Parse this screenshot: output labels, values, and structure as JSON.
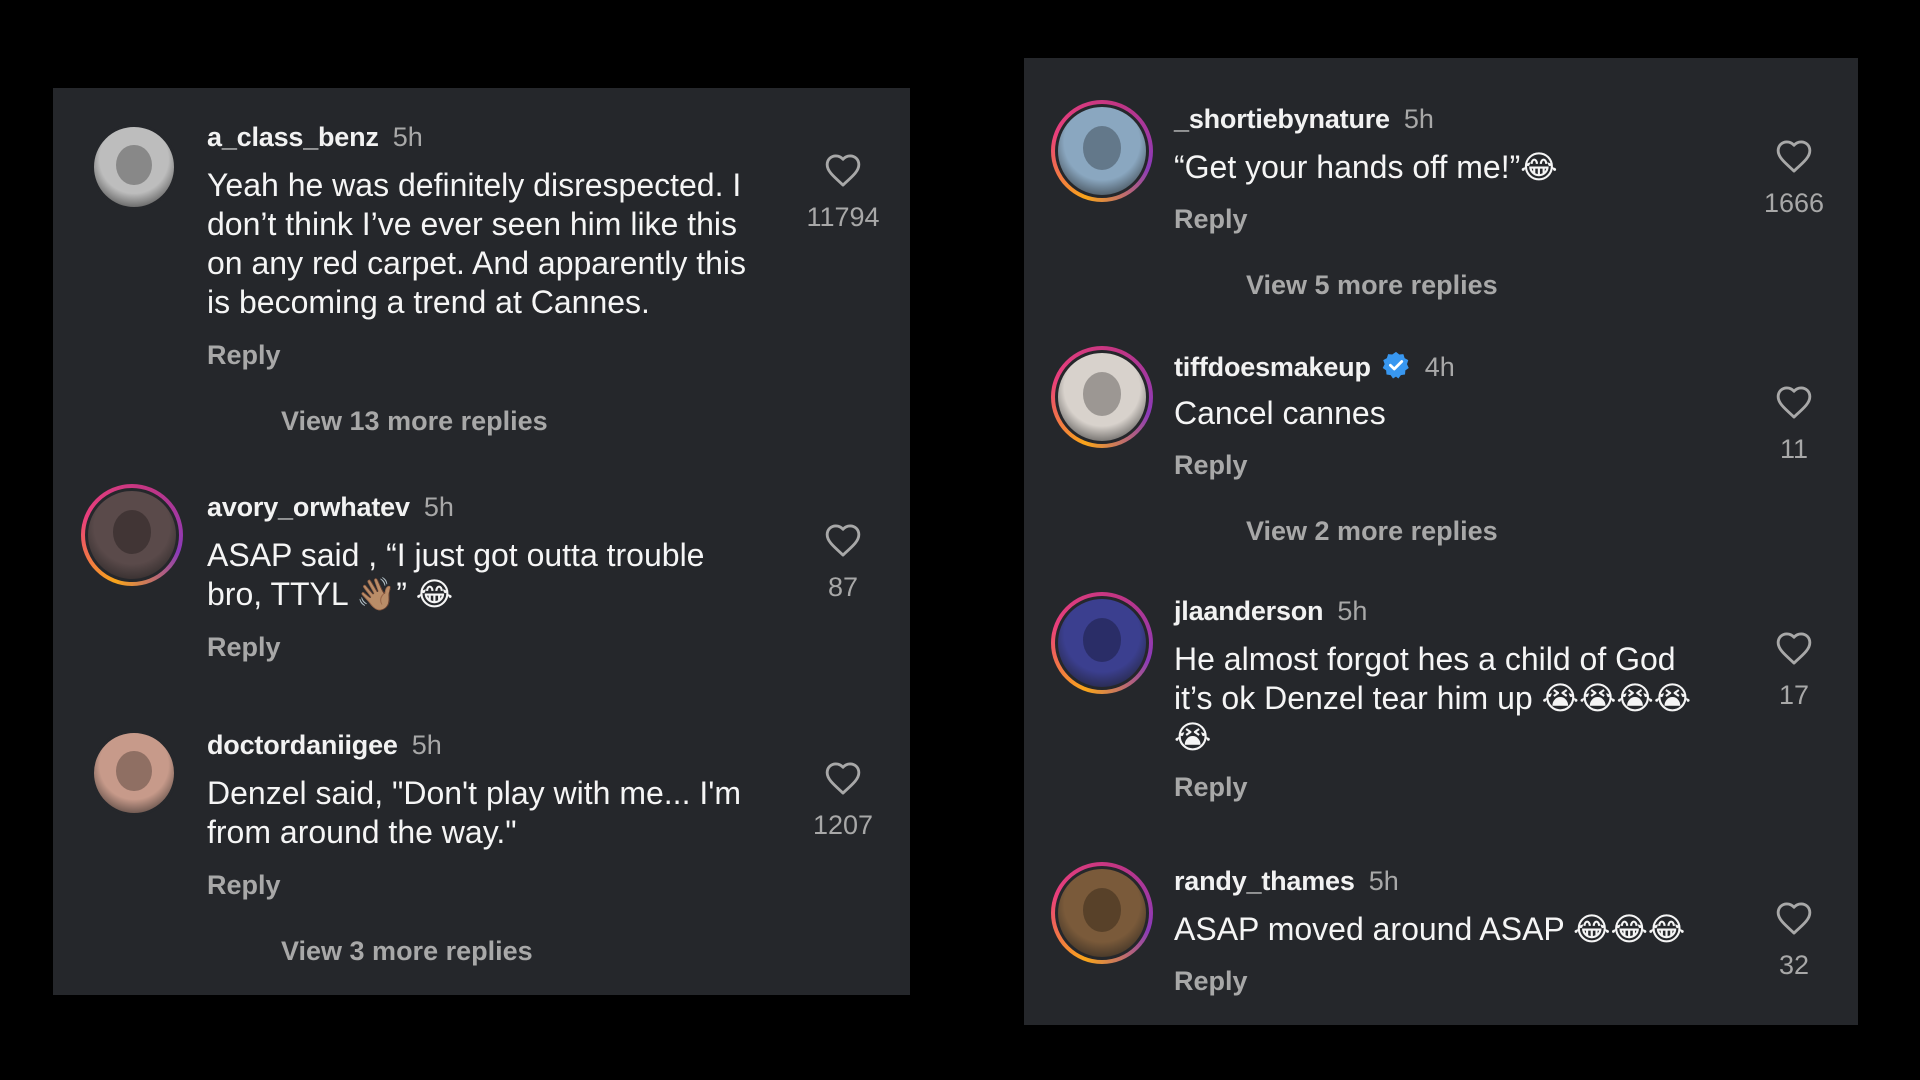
{
  "left": {
    "comments": [
      {
        "username": "a_class_benz",
        "time": "5h",
        "text": "Yeah he was definitely disrespected. I\ndon’t think I’ve ever seen him like this\non any red carpet. And apparently this\nis becoming a trend at Cannes.",
        "reply": "Reply",
        "likes": "11794",
        "view_more": "View 13 more replies",
        "avatar_color": "#bdbdbd",
        "story_ring": false
      },
      {
        "username": "avory_orwhatev",
        "time": "5h",
        "text": "ASAP said , “I just got outta trouble\nbro, TTYL 👋🏽” 😂",
        "reply": "Reply",
        "likes": "87",
        "avatar_color": "#5a4a4a",
        "story_ring": true
      },
      {
        "username": "doctordaniigee",
        "time": "5h",
        "text": "Denzel said, \"Don't play with me... I'm\nfrom around the way.\"",
        "reply": "Reply",
        "likes": "1207",
        "view_more": "View 3 more replies",
        "avatar_color": "#c79a8a",
        "story_ring": false
      }
    ]
  },
  "right": {
    "comments": [
      {
        "username": "_shortiebynature",
        "time": "5h",
        "text": "“Get your hands off me!”😂",
        "reply": "Reply",
        "likes": "1666",
        "view_more": "View 5 more replies",
        "avatar_color": "#8aa7c0",
        "story_ring": true
      },
      {
        "username": "tiffdoesmakeup",
        "time": "4h",
        "verified": true,
        "text": "Cancel cannes",
        "reply": "Reply",
        "likes": "11",
        "view_more": "View 2 more replies",
        "avatar_color": "#d8d2cc",
        "story_ring": true
      },
      {
        "username": "jlaanderson",
        "time": "5h",
        "text": "He almost forgot hes a child of God\nit’s ok Denzel tear him up 😭😭😭😭\n😭",
        "reply": "Reply",
        "likes": "17",
        "avatar_color": "#3b3f8f",
        "story_ring": true
      },
      {
        "username": "randy_thames",
        "time": "5h",
        "text": "ASAP moved around ASAP 😂😂😂",
        "reply": "Reply",
        "likes": "32",
        "avatar_color": "#7a5a3a",
        "story_ring": true
      }
    ]
  },
  "icons": {
    "like": "heart-outline-icon",
    "verified": "verified-badge-icon"
  },
  "colors": {
    "background": "#000000",
    "panel": "#25272b",
    "primary_text": "#f5f5f5",
    "secondary_text": "#a8a8a8",
    "verified_blue": "#3897f0"
  }
}
